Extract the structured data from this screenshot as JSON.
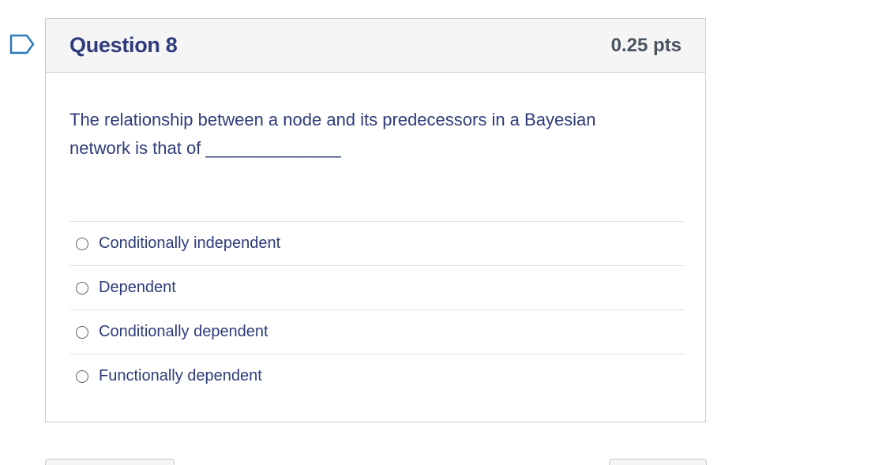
{
  "question": {
    "flag_icon": "bookmark-flag-icon",
    "title": "Question 8",
    "points": "0.25 pts",
    "text": "The relationship between a node and its predecessors in a Bayesian network is that of ______________",
    "answers": [
      {
        "label": "Conditionally independent",
        "selected": false
      },
      {
        "label": "Dependent",
        "selected": false
      },
      {
        "label": "Conditionally dependent",
        "selected": false
      },
      {
        "label": "Functionally dependent",
        "selected": false
      }
    ]
  },
  "colors": {
    "accent": "#2d3b7a",
    "flag": "#2b7abc",
    "border": "#c7cdd1",
    "header_bg": "#f5f5f5"
  }
}
